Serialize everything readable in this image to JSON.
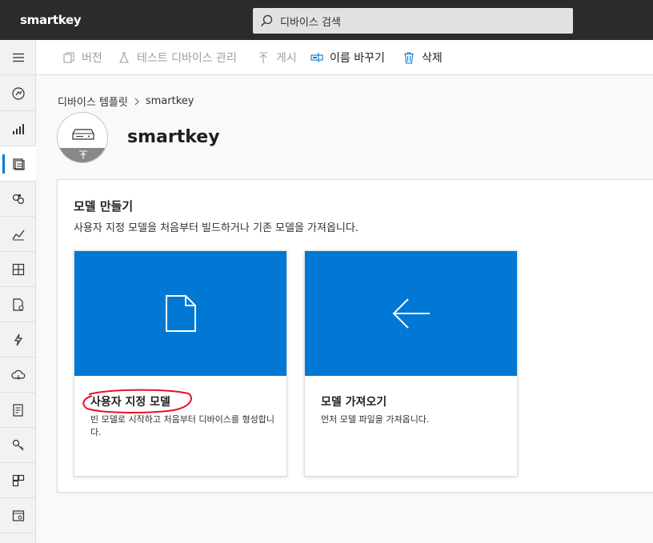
{
  "app": {
    "brand": "smartkey"
  },
  "search": {
    "placeholder": "디바이스 검색"
  },
  "commands": {
    "version": "버전",
    "test_device": "테스트 디바이스 관리",
    "publish": "게시",
    "rename": "이름 바꾸기",
    "delete": "삭제"
  },
  "breadcrumb": {
    "parent": "디바이스 템플릿",
    "current": "smartkey"
  },
  "page": {
    "title": "smartkey"
  },
  "panel": {
    "heading": "모델 만들기",
    "subtitle": "사용자 지정 모델을 처음부터 빌드하거나 기존 모델을 가져옵니다."
  },
  "cards": [
    {
      "title": "사용자 지정 모델",
      "description": "빈 모델로 시작하고 처음부터 디바이스를 형성합니다."
    },
    {
      "title": "모델 가져오기",
      "description": "먼저 모델 파일을 가져옵니다."
    }
  ],
  "rail": {
    "icons": [
      "menu-icon",
      "dashboard-icon",
      "devices-icon",
      "device-templates-icon",
      "device-groups-icon",
      "analytics-icon",
      "dashboards-icon",
      "jobs-icon",
      "rules-icon",
      "data-export-icon",
      "audit-icon",
      "keys-icon",
      "extensibility-icon",
      "settings-icon"
    ]
  },
  "colors": {
    "accent": "#0078d4",
    "topbar": "#2b2b2b",
    "annotation": "#e81123"
  }
}
